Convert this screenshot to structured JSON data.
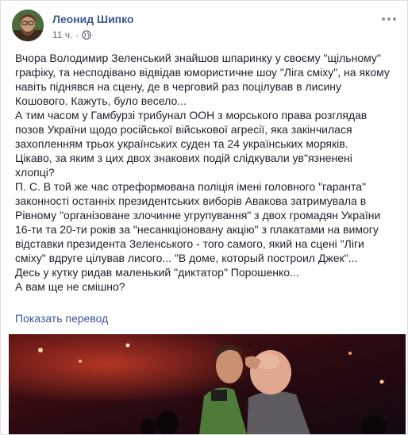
{
  "post": {
    "author": "Леонид Шипко",
    "time": "11 ч.",
    "separator": "·",
    "privacy_icon": "globe-icon",
    "more_icon": "more-options-icon",
    "paragraphs": [
      "Вчора Володимир Зеленський знайшов шпаринку у своєму \"щільному\" графіку, та несподівано відвідав юмористичне шоу \"Ліга сміху\", на якому навіть піднявся на сцену, де в черговий раз поцілував в лисину Кошового. Кажуть, було весело...",
      "А тим часом у Гамбурзі трибунал ООН з морського права розглядав позов України щодо російської військової агресії, яка закінчилася захопленням трьох українських суден та 24 українських моряків.",
      "Цікаво, за яким з цих двох знакових подій слідкували ув\"язненені хлопці?",
      "П. С. В той же час отреформована поліція імені головного \"гаранта\" законності останніх президентських виборів Авакова затримувала в Рівному \"організоване злочинне угрупування\" з двох громадян України 16-ти та 20-ти років за \"несанкціоновану акцію\" з плакатами на вимогу відставки президента Зеленського - того самого, який на сцені \"Ліги сміху\" вдруге цілував лисого... \"В доме, который построил Джек\"...",
      "Десь у кутку ридав маленький \"диктатор\" Порошенко...",
      "А вам ще не смішно?"
    ],
    "translate_link": "Показать перевод",
    "photo_description": "stage-photo"
  },
  "colors": {
    "link": "#385898",
    "text": "#1d2129",
    "meta": "#616770",
    "background": "#e9ebee"
  }
}
